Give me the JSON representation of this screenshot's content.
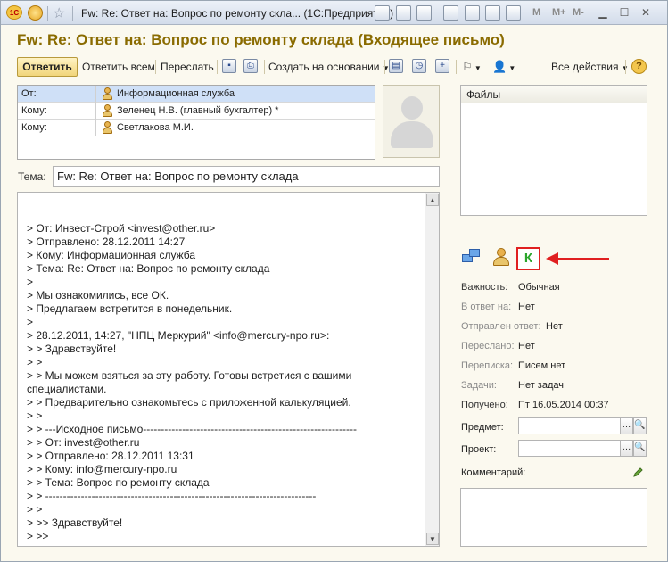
{
  "titlebar": {
    "logo": "1С",
    "title": "Fw: Re: Ответ на: Вопрос по ремонту скла...  (1С:Предприятие)",
    "m_buttons": [
      "M",
      "M+",
      "M-"
    ]
  },
  "heading": "Fw: Re: Ответ на: Вопрос по ремонту склада (Входящее письмо)",
  "toolbar": {
    "reply": "Ответить",
    "reply_all": "Ответить всем",
    "forward": "Переслать",
    "create_based_on": "Создать на основании",
    "all_actions": "Все действия",
    "help": "?"
  },
  "addresses": [
    {
      "label": "От:",
      "value": "Информационная служба"
    },
    {
      "label": "Кому:",
      "value": "Зеленец Н.В. (главный бухгалтер) *"
    },
    {
      "label": "Кому:",
      "value": "Светлакова М.И."
    }
  ],
  "subject": {
    "label": "Тема:",
    "value": "Fw: Re: Ответ на: Вопрос по ремонту склада"
  },
  "body_lines": [
    "> От: Инвест-Строй <invest@other.ru>",
    "> Отправлено: 28.12.2011 14:27",
    "> Кому: Информационная служба",
    "> Тема: Re: Ответ на: Вопрос по ремонту склада",
    ">",
    "> Мы ознакомились, все ОК.",
    "> Предлагаем встретится в понедельник.",
    ">",
    "> 28.12.2011, 14:27, \"НПЦ Меркурий\" <info@mercury-npo.ru>:",
    "> > Здравствуйте!",
    "> >",
    "> > Мы можем взяться за эту работу. Готовы встретися с вашими специалистами.",
    "> > Предварительно ознакомьтесь с приложенной калькуляцией.",
    "> >",
    "> > ---Исходное письмо------------------------------------------------------------",
    "> > От: invest@other.ru",
    "> > Отправлено: 28.12.2011 13:31",
    "> > Кому: info@mercury-npo.ru",
    "> > Тема: Вопрос по ремонту склада",
    "> > ----------------------------------------------------------------------------",
    "> >",
    "> >> Здравствуйте!",
    "> >>"
  ],
  "files": {
    "header": "Файлы"
  },
  "k_marker": "К",
  "properties": {
    "importance": {
      "label": "Важность:",
      "value": "Обычная"
    },
    "in_reply_to": {
      "label": "В ответ на:",
      "value": "Нет"
    },
    "reply_sent": {
      "label": "Отправлен ответ:",
      "value": "Нет"
    },
    "forwarded": {
      "label": "Переслано:",
      "value": "Нет"
    },
    "thread": {
      "label": "Переписка:",
      "value": "Писем нет"
    },
    "tasks": {
      "label": "Задачи:",
      "value": "Нет задач"
    },
    "received": {
      "label": "Получено:",
      "value": "Пт 16.05.2014 00:37"
    },
    "subject_field": {
      "label": "Предмет:",
      "value": ""
    },
    "project_field": {
      "label": "Проект:",
      "value": ""
    },
    "comment": {
      "label": "Комментарий:",
      "value": ""
    }
  },
  "colors": {
    "heading": "#8a6b00",
    "highlight_box": "#e02020",
    "k_letter": "#2aa52a",
    "selected_row": "#cfe0f7"
  }
}
